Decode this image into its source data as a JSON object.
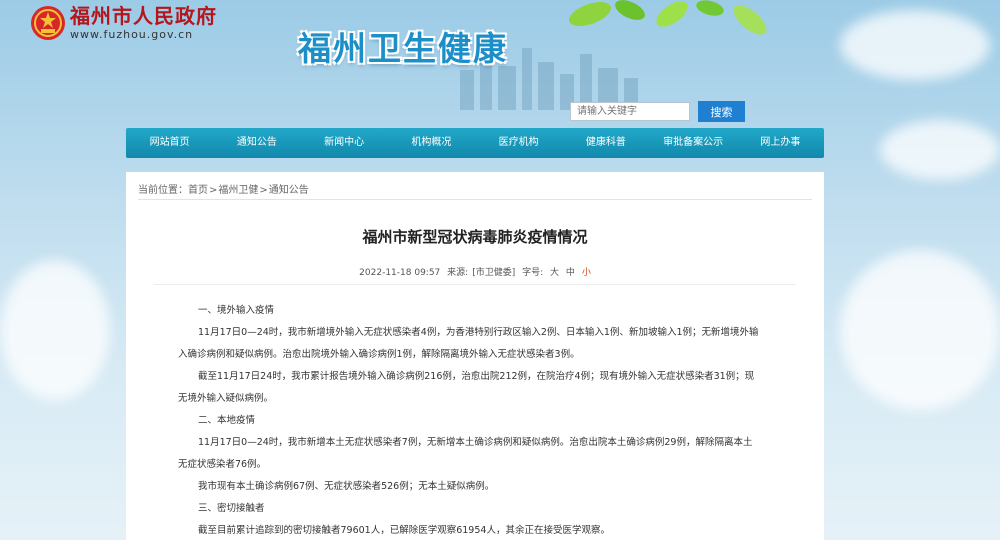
{
  "header": {
    "site_name": "福州市人民政府",
    "site_url": "www.fuzhou.gov.cn",
    "banner_title": "福州卫生健康",
    "search_placeholder": "请输入关键字",
    "search_button": "搜索"
  },
  "nav": {
    "items": [
      "网站首页",
      "通知公告",
      "新闻中心",
      "机构概况",
      "医疗机构",
      "健康科普",
      "审批备案公示",
      "网上办事"
    ]
  },
  "breadcrumb": {
    "prefix": "当前位置：",
    "items": [
      "首页",
      "福州卫健",
      "通知公告"
    ],
    "separator": ">"
  },
  "article": {
    "title": "福州市新型冠状病毒肺炎疫情情况",
    "date": "2022-11-18 09:57",
    "source_label": "来源:",
    "source": "[市卫健委]",
    "font_label": "字号:",
    "font_large": "大",
    "font_medium": "中",
    "font_small": "小",
    "paragraphs": [
      "一、境外输入疫情",
      "11月17日0—24时，我市新增境外输入无症状感染者4例，为香港特别行政区输入2例、日本输入1例、新加坡输入1例；无新增境外输",
      "入确诊病例和疑似病例。治愈出院境外输入确诊病例1例，解除隔离境外输入无症状感染者3例。",
      "截至11月17日24时，我市累计报告境外输入确诊病例216例，治愈出院212例，在院治疗4例；现有境外输入无症状感染者31例；现",
      "无境外输入疑似病例。",
      "二、本地疫情",
      "11月17日0—24时，我市新增本土无症状感染者7例，无新增本土确诊病例和疑似病例。治愈出院本土确诊病例29例，解除隔离本土",
      "无症状感染者76例。",
      "我市现有本土确诊病例67例、无症状感染者526例；无本土疑似病例。",
      "三、密切接触者",
      "截至目前累计追踪到的密切接触者79601人，已解除医学观察61954人，其余正在接受医学观察。"
    ]
  },
  "colors": {
    "site_name": "#b4161b",
    "banner": "#1d8fc8",
    "nav": "#1a97bb",
    "search_button": "#1f7fd1",
    "font_small_active": "#d44a1c"
  }
}
